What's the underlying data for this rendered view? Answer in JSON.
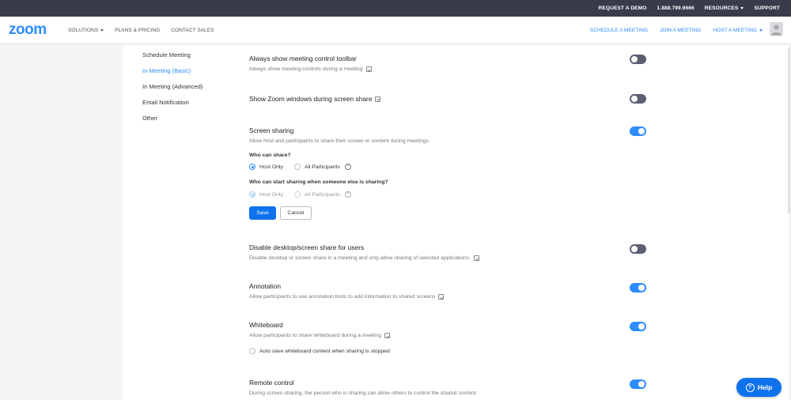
{
  "topbar": {
    "request_demo": "REQUEST A DEMO",
    "phone": "1.888.799.9666",
    "resources": "RESOURCES",
    "support": "SUPPORT"
  },
  "header": {
    "logo": "zoom",
    "nav_left": [
      "SOLUTIONS",
      "PLANS & PRICING",
      "CONTACT SALES"
    ],
    "nav_right": [
      "SCHEDULE A MEETING",
      "JOIN A MEETING",
      "HOST A MEETING"
    ]
  },
  "submenu": {
    "items": [
      "Schedule Meeting",
      "In Meeting (Basic)",
      "In Meeting (Advanced)",
      "Email Notification",
      "Other"
    ],
    "active": "In Meeting (Basic)"
  },
  "settings": [
    {
      "title": "Always show meeting control toolbar",
      "desc": "Always show meeting controls during a meeting",
      "enabled": false
    },
    {
      "title": "Show Zoom windows during screen share",
      "desc": "",
      "enabled": false
    },
    {
      "title": "Screen sharing",
      "desc": "Allow host and participants to share their screen or content during meetings",
      "enabled": true
    },
    {
      "title": "Disable desktop/screen share for users",
      "desc": "Disable desktop or screen share in a meeting and only allow sharing of selected applications.",
      "enabled": false
    },
    {
      "title": "Annotation",
      "desc": "Allow participants to use annotation tools to add information to shared screens",
      "enabled": true
    },
    {
      "title": "Whiteboard",
      "desc": "Allow participants to share whiteboard during a meeting",
      "enabled": true
    },
    {
      "title": "Remote control",
      "desc": "During screen sharing, the person who is sharing can allow others to control the shared content",
      "enabled": true
    }
  ],
  "screen_sharing": {
    "who_can_share_label": "Who can share?",
    "who_can_share_options": [
      "Host Only",
      "All Participants"
    ],
    "who_can_share_selected": "Host Only",
    "who_can_start_label": "Who can start sharing when someone else is sharing?",
    "who_can_start_options": [
      "Host Only",
      "All Participants"
    ],
    "who_can_start_selected": "Host Only",
    "save_label": "Save",
    "cancel_label": "Cancel",
    "question_mark": "?"
  },
  "whiteboard_option": {
    "label": "Auto save whiteboard content when sharing is stopped",
    "checked": false
  },
  "help": {
    "label": "Help",
    "icon_text": "?"
  },
  "colors": {
    "accent": "#2d8cff",
    "button": "#0e72ed",
    "topbar": "#393a4a",
    "toggle_off": "#5c5f73"
  }
}
